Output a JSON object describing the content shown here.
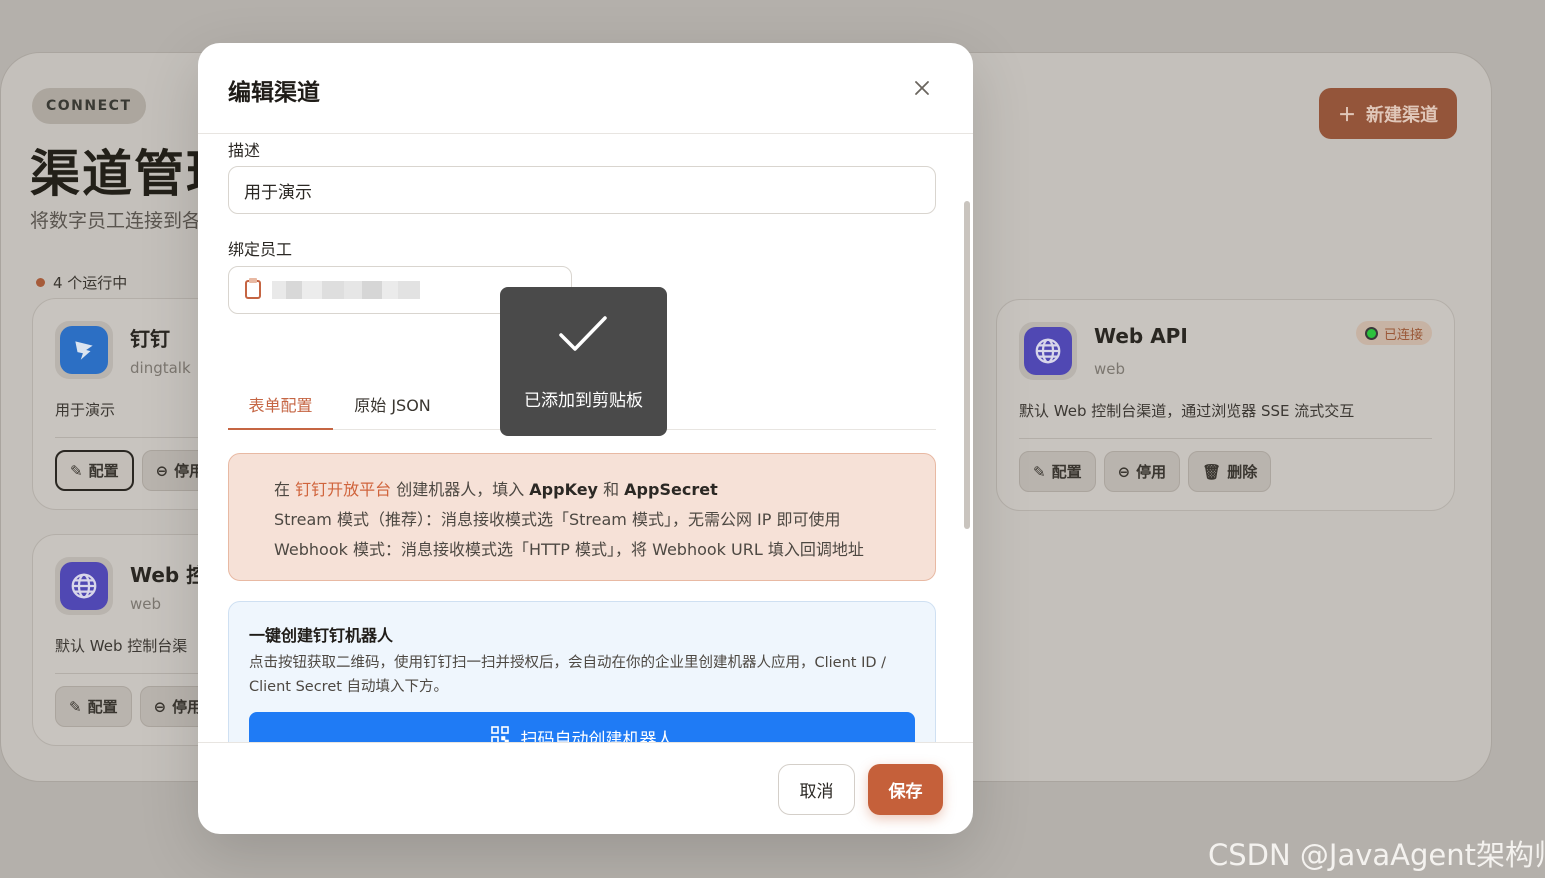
{
  "background": {
    "tag": "CONNECT",
    "title": "渠道管理",
    "subtitle": "将数字员工连接到各",
    "running": "4 个运行中",
    "new_button": "新建渠道",
    "new_button_icon": "plus-icon",
    "cards": [
      {
        "name": "钉钉",
        "type": "dingtalk",
        "desc": "用于演示",
        "icon": "dingtalk-logo-icon",
        "actions": [
          "配置",
          "停用"
        ]
      },
      {
        "name": "Web 控",
        "type": "web",
        "desc": "默认 Web 控制台渠",
        "icon": "globe-icon",
        "actions": [
          "配置",
          "停用"
        ]
      },
      {
        "name": "Web API",
        "type": "web",
        "desc": "默认 Web 控制台渠道，通过浏览器 SSE 流式交互",
        "icon": "globe-icon",
        "status": "已连接",
        "actions": [
          "配置",
          "停用",
          "删除"
        ]
      }
    ]
  },
  "modal": {
    "title": "编辑渠道",
    "close_icon": "close-icon",
    "desc_label": "描述",
    "desc_value": "用于演示",
    "employee_label": "绑定员工",
    "tabs": [
      "表单配置",
      "原始 JSON"
    ],
    "active_tab": "表单配置",
    "info": {
      "line1_prefix": "在 ",
      "line1_link": "钉钉开放平台",
      "line1_mid": " 创建机器人，填入 ",
      "line1_key": "AppKey",
      "line1_and": " 和 ",
      "line1_secret": "AppSecret",
      "line2": "Stream 模式（推荐）：消息接收模式选「Stream 模式」，无需公网 IP 即可使用",
      "line3": "Webhook 模式：消息接收模式选「HTTP 模式」，将 Webhook URL 填入回调地址"
    },
    "qr": {
      "title": "一键创建钉钉机器人",
      "desc": "点击按钮获取二维码，使用钉钉扫一扫并授权后，会自动在你的企业里创建机器人应用，Client ID / Client Secret 自动填入下方。",
      "button": "扫码自动创建机器人",
      "button_icon": "qrcode-icon"
    },
    "cancel": "取消",
    "save": "保存"
  },
  "toast": {
    "message": "已添加到剪贴板",
    "icon": "checkmark-icon"
  },
  "watermark": "CSDN @JavaAgent架构师",
  "colors": {
    "accent": "#c5603a",
    "primary_blue": "#1f7bf5",
    "status_green": "#2dc23d"
  }
}
